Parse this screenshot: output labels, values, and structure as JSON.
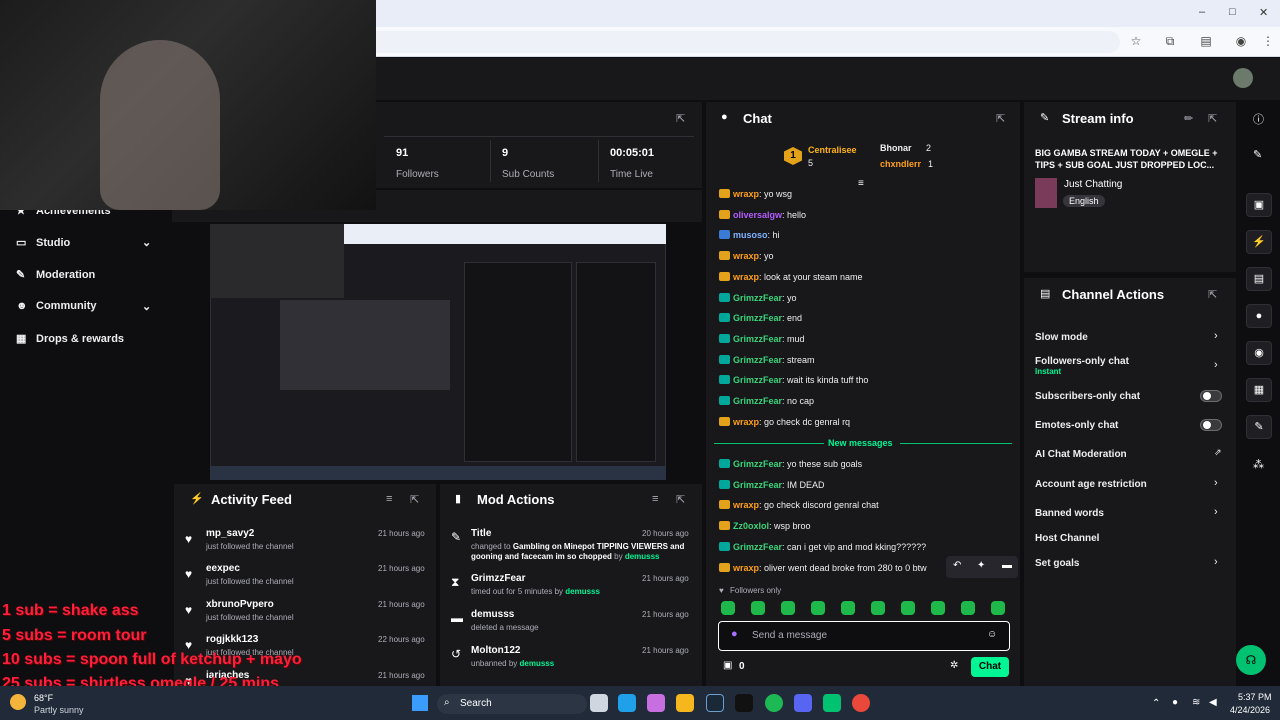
{
  "colors": {
    "accent": "#00f593",
    "purple": "#9147ff",
    "bg": "#0e0e10",
    "panel": "#18181b",
    "red_overlay": "#ff1f3d"
  },
  "browser": {
    "minimize": "–",
    "maximize": "□",
    "close": "✕"
  },
  "sidebar": {
    "items": [
      {
        "label": "Achievements"
      },
      {
        "label": "Studio"
      },
      {
        "label": "Moderation"
      },
      {
        "label": "Community"
      },
      {
        "label": "Drops & rewards"
      }
    ]
  },
  "stats": [
    {
      "value": "91",
      "label": "Followers"
    },
    {
      "value": "9",
      "label": "Sub Counts"
    },
    {
      "value": "00:05:01",
      "label": "Time Live"
    }
  ],
  "chat": {
    "title": "Chat",
    "leaderboard": [
      {
        "rank": "1",
        "name": "Centralisee",
        "count": "5"
      },
      {
        "name": "Bhonar",
        "count": "2"
      },
      {
        "name": "chxndlerr",
        "count": "1"
      }
    ],
    "messages": [
      {
        "user": "wraxp",
        "text": ": yo wsg",
        "color": "#ff9f1a",
        "badge": "#e3a21a"
      },
      {
        "user": "oliversalgw",
        "text": ": hello",
        "color": "#b45cff",
        "badge": "#e3a21a"
      },
      {
        "user": "musoso",
        "text": ": hi",
        "color": "#7fb2ff",
        "badge": "#3a7bd5"
      },
      {
        "user": "wraxp",
        "text": ": yo",
        "color": "#ff9f1a",
        "badge": "#e3a21a"
      },
      {
        "user": "wraxp",
        "text": ": look at your steam name",
        "color": "#ff9f1a",
        "badge": "#e3a21a"
      },
      {
        "user": "GrimzzFear",
        "text": ": yo",
        "color": "#3ad47a",
        "badge": "#00a89c"
      },
      {
        "user": "GrimzzFear",
        "text": ": end",
        "color": "#3ad47a",
        "badge": "#00a89c"
      },
      {
        "user": "GrimzzFear",
        "text": ": mud",
        "color": "#3ad47a",
        "badge": "#00a89c"
      },
      {
        "user": "GrimzzFear",
        "text": ": stream",
        "color": "#3ad47a",
        "badge": "#00a89c"
      },
      {
        "user": "GrimzzFear",
        "text": ": wait its kinda tuff tho",
        "color": "#3ad47a",
        "badge": "#00a89c"
      },
      {
        "user": "GrimzzFear",
        "text": ": no cap",
        "color": "#3ad47a",
        "badge": "#00a89c"
      },
      {
        "user": "wraxp",
        "text": ": go check dc genral rq",
        "color": "#ff9f1a",
        "badge": "#e3a21a"
      }
    ],
    "new_messages_label": "New messages",
    "new_messages": [
      {
        "user": "GrimzzFear",
        "text": ": yo these sub goals",
        "color": "#3ad47a",
        "badge": "#00a89c"
      },
      {
        "user": "GrimzzFear",
        "text": ": IM DEAD",
        "color": "#3ad47a",
        "badge": "#00a89c"
      },
      {
        "user": "wraxp",
        "text": ": go check discord genral chat",
        "color": "#ff9f1a",
        "badge": "#e3a21a"
      },
      {
        "user": "Zz0oxlol",
        "text": ": wsp broo",
        "color": "#3ad47a",
        "badge": "#e3a21a"
      },
      {
        "user": "GrimzzFear",
        "text": ": can i get vip and mod kking??????",
        "color": "#3ad47a",
        "badge": "#00a89c"
      },
      {
        "user": "wraxp",
        "text": ": oliver went dead broke from 280 to 0 btw",
        "color": "#ff9f1a",
        "badge": "#e3a21a"
      }
    ],
    "followers_only": "Followers only",
    "input_placeholder": "Send a message",
    "points": "0",
    "send_label": "Chat"
  },
  "stream_info": {
    "title": "Stream info",
    "stream_title": "BIG GAMBA STREAM TODAY + OMEGLE + TIPS + SUB GOAL JUST DROPPED LOC...",
    "category": "Just Chatting",
    "tag": "English"
  },
  "channel_actions": {
    "title": "Channel Actions",
    "items": [
      {
        "label": "Slow mode"
      },
      {
        "label": "Followers-only chat",
        "sub": "Instant"
      },
      {
        "label": "Subscribers-only chat"
      },
      {
        "label": "Emotes-only chat"
      },
      {
        "label": "AI Chat Moderation"
      },
      {
        "label": "Account age restriction"
      },
      {
        "label": "Banned words"
      },
      {
        "label": "Host Channel"
      },
      {
        "label": "Set goals"
      }
    ]
  },
  "activity_feed": {
    "title": "Activity Feed",
    "items": [
      {
        "name": "mp_savy2",
        "sub": "just followed the channel",
        "time": "21 hours ago"
      },
      {
        "name": "eexpec",
        "sub": "just followed the channel",
        "time": "21 hours ago"
      },
      {
        "name": "xbrunoPvpero",
        "sub": "just followed the channel",
        "time": "21 hours ago"
      },
      {
        "name": "rogjkkk123",
        "sub": "just followed the channel",
        "time": "22 hours ago"
      },
      {
        "name": "iariaches",
        "sub": "",
        "time": "21 hours ago"
      }
    ]
  },
  "mod_actions": {
    "title": "Mod Actions",
    "items": [
      {
        "name": "Title",
        "pre": "changed to ",
        "bold": "Gambling on Minepot TIPPING VIEWERS and gooning and facecam im so chopped",
        "post": " by ",
        "by": "demusss",
        "time": "20 hours ago"
      },
      {
        "name": "GrimzzFear",
        "pre": "timed out for 5 minutes by ",
        "bold": "",
        "post": "",
        "by": "demusss",
        "time": "21 hours ago"
      },
      {
        "name": "demusss",
        "pre": "deleted a message",
        "bold": "",
        "post": "",
        "by": "",
        "time": "21 hours ago"
      },
      {
        "name": "Molton122",
        "pre": "unbanned by ",
        "bold": "",
        "post": "",
        "by": "demusss",
        "time": "21 hours ago"
      }
    ]
  },
  "overlay": {
    "lines": [
      "1 sub = shake ass",
      "5 subs = room tour",
      "10 subs = spoon full of ketchup + mayo",
      "25 subs = shirtless omegle / 25 mins"
    ]
  },
  "taskbar": {
    "weather_temp": "68°F",
    "weather_desc": "Partly sunny",
    "search": "Search",
    "time": "5:37 PM",
    "date": "4/24/2026"
  }
}
